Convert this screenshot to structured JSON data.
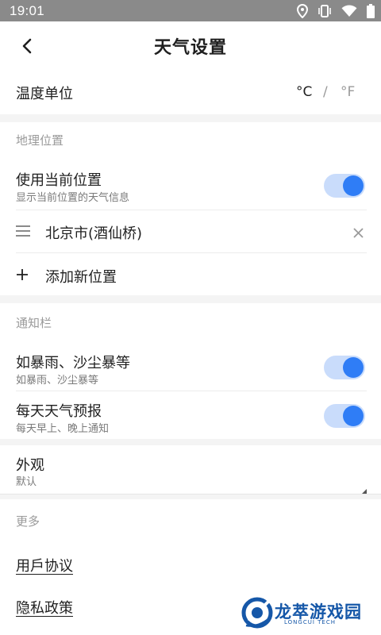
{
  "status_bar": {
    "time": "19:01"
  },
  "header": {
    "title": "天气设置"
  },
  "temperature": {
    "label": "温度单位",
    "celsius": "°C",
    "separator": "/",
    "fahrenheit": "°F"
  },
  "location": {
    "section_title": "地理位置",
    "use_current": {
      "label": "使用当前位置",
      "sub": "显示当前位置的天气信息",
      "enabled": true
    },
    "saved_city": "北京市(酒仙桥)",
    "add_label": "添加新位置"
  },
  "notification": {
    "section_title": "通知栏",
    "storm": {
      "label": "如暴雨、沙尘暴等",
      "sub": "如暴雨、沙尘暴等",
      "enabled": true
    },
    "daily": {
      "label": "每天天气预报",
      "sub": "每天早上、晚上通知",
      "enabled": true
    }
  },
  "appearance": {
    "label": "外观",
    "value": "默认"
  },
  "more": {
    "section_title": "更多",
    "agreement": "用戶协议",
    "privacy": "隐私政策"
  },
  "watermark": {
    "text": "龙萃游戏园",
    "sub": "LONGCUI TECH"
  },
  "colors": {
    "accent": "#2f7df6",
    "track": "#c9dcfb",
    "status_bar": "#8a8a8a"
  }
}
